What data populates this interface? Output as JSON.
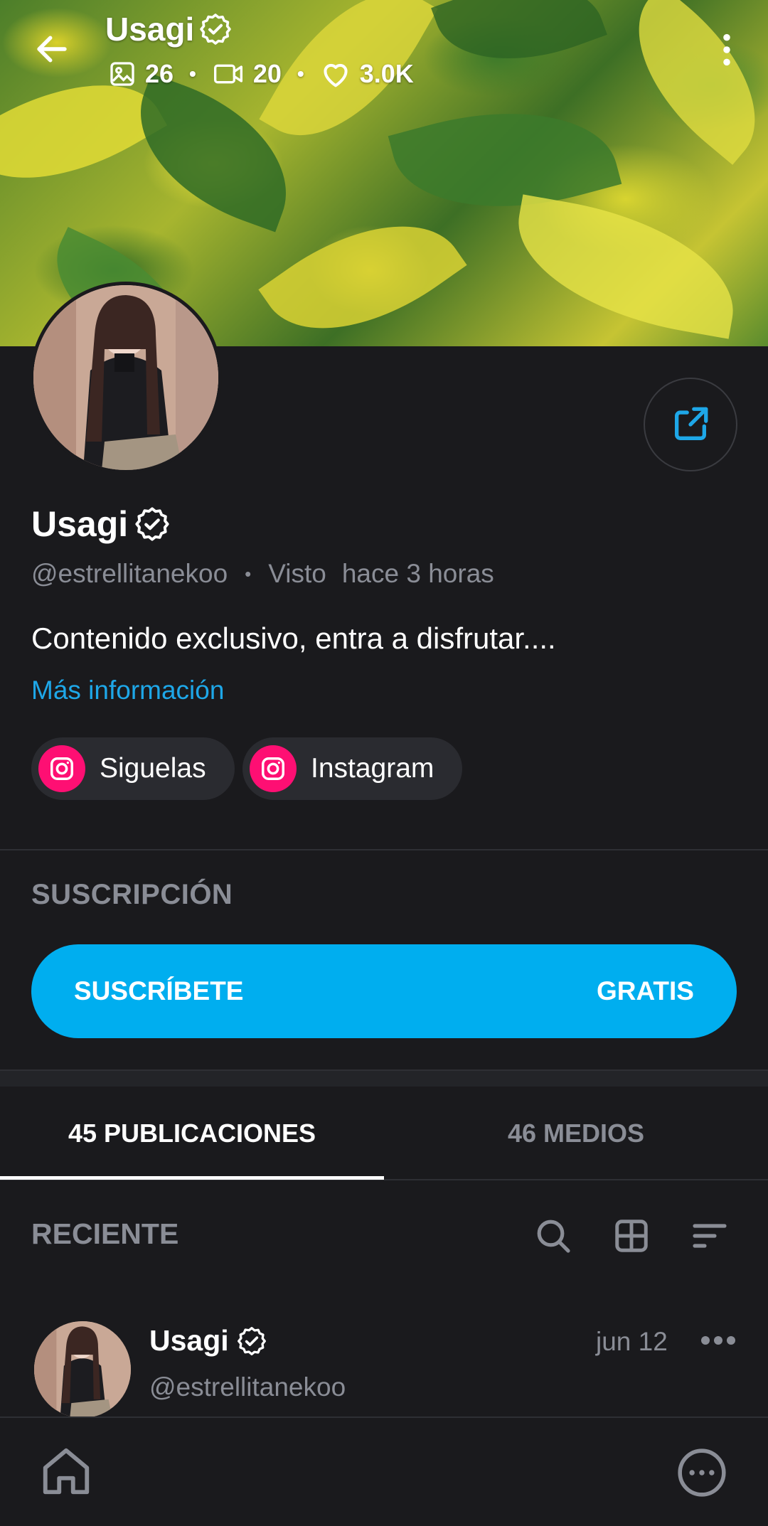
{
  "header": {
    "name": "Usagi",
    "stats": {
      "photos": "26",
      "videos": "20",
      "likes": "3.0K"
    },
    "separator": "•"
  },
  "profile": {
    "name": "Usagi",
    "handle": "@estrellitanekoo",
    "separator": "•",
    "seen_label": "Visto",
    "seen_time": "hace 3 horas",
    "bio": "Contenido exclusivo, entra a disfrutar....",
    "more_info": "Más información"
  },
  "social_links": [
    {
      "label": "Siguelas",
      "icon": "instagram-icon"
    },
    {
      "label": "Instagram",
      "icon": "instagram-icon"
    }
  ],
  "subscription": {
    "title": "SUSCRIPCIÓN",
    "button_label": "SUSCRÍBETE",
    "price": "GRATIS"
  },
  "tabs": [
    {
      "label": "45 PUBLICACIONES",
      "active": true
    },
    {
      "label": "46 MEDIOS",
      "active": false
    }
  ],
  "feed": {
    "sort_label": "RECIENTE",
    "tools": [
      "search-icon",
      "grid-icon",
      "sort-icon"
    ]
  },
  "post": {
    "author_name": "Usagi",
    "author_handle": "@estrellitanekoo",
    "date": "jun 12"
  },
  "colors": {
    "background": "#1a1a1d",
    "accent": "#00aeef",
    "link": "#1ea7e8",
    "instagram": "#fe0f73",
    "muted_text": "#8a8d96"
  }
}
